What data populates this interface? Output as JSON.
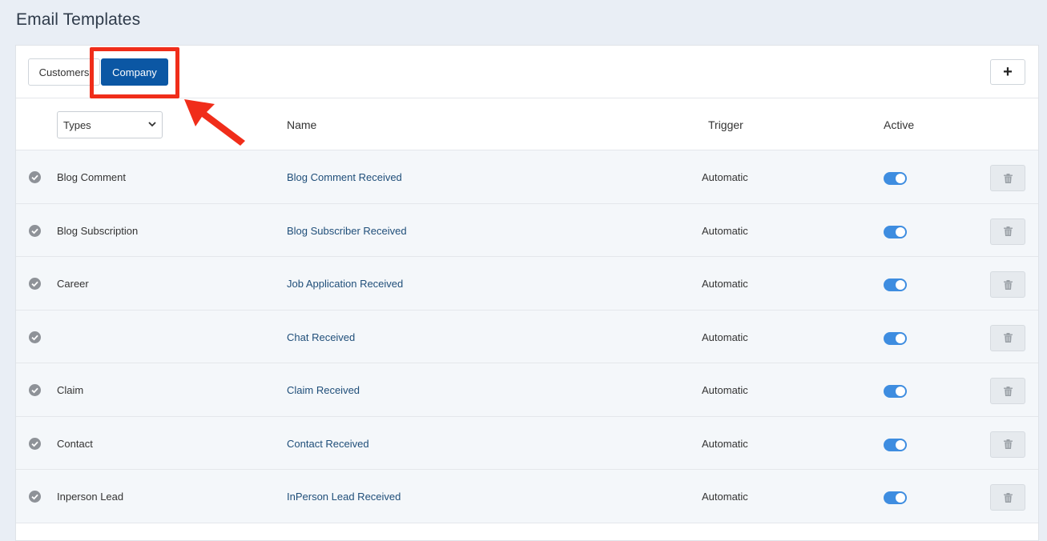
{
  "page": {
    "title": "Email Templates"
  },
  "toolbar": {
    "tabs": [
      {
        "label": "Customers",
        "active": false
      },
      {
        "label": "Company",
        "active": true
      }
    ],
    "add_label": "+"
  },
  "filter": {
    "types_selected": "Types"
  },
  "table": {
    "headers": {
      "name": "Name",
      "trigger": "Trigger",
      "active": "Active"
    },
    "rows": [
      {
        "type": "Blog Comment",
        "name": "Blog Comment Received",
        "trigger": "Automatic",
        "active": true
      },
      {
        "type": "Blog Subscription",
        "name": "Blog Subscriber Received",
        "trigger": "Automatic",
        "active": true
      },
      {
        "type": "Career",
        "name": "Job Application Received",
        "trigger": "Automatic",
        "active": true
      },
      {
        "type": "",
        "name": "Chat Received",
        "trigger": "Automatic",
        "active": true
      },
      {
        "type": "Claim",
        "name": "Claim Received",
        "trigger": "Automatic",
        "active": true
      },
      {
        "type": "Contact",
        "name": "Contact Received",
        "trigger": "Automatic",
        "active": true
      },
      {
        "type": "Inperson Lead",
        "name": "InPerson Lead Received",
        "trigger": "Automatic",
        "active": true
      }
    ]
  },
  "icons": {
    "check": "check-circle-icon",
    "delete": "trash-icon",
    "add": "plus-icon",
    "dropdown": "chevron-down-icon"
  },
  "colors": {
    "primary": "#0b57a4",
    "toggle_on": "#3e8de0",
    "link": "#1f4e79",
    "annotation": "#f02d1a"
  }
}
